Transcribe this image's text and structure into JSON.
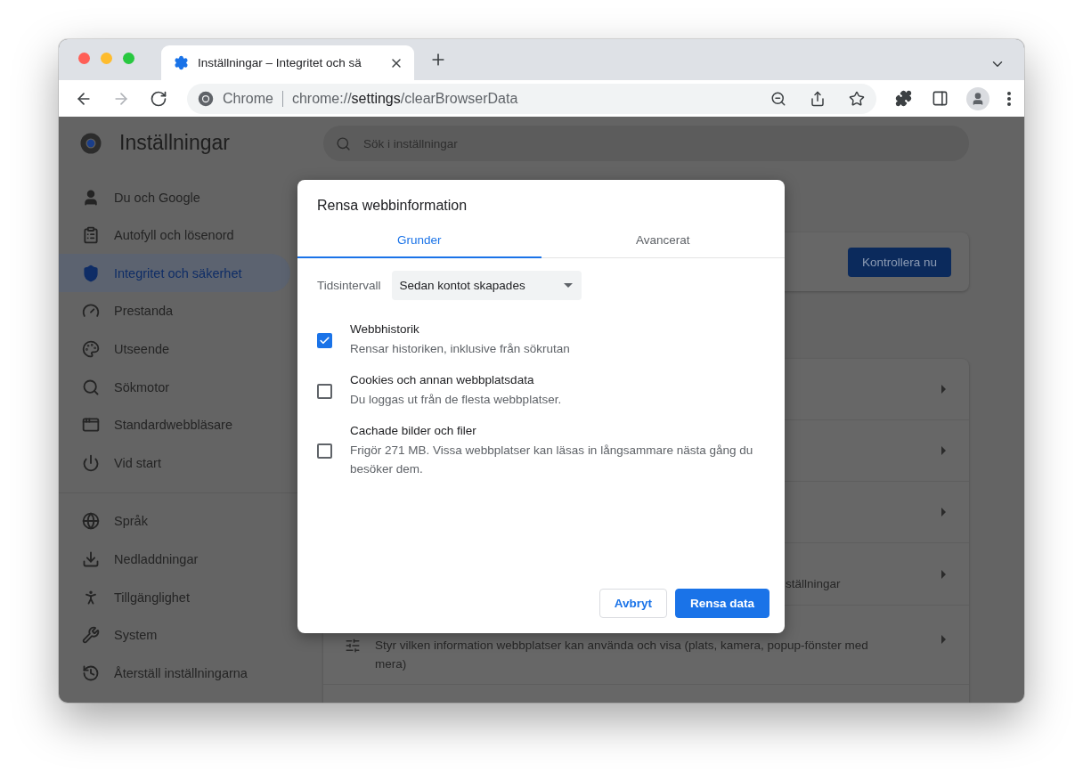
{
  "browser": {
    "tabs": [
      {
        "title": "Inställningar – Integritet och sä",
        "selected": true
      }
    ],
    "nav_buttons": [
      {
        "kind": "back",
        "disabled": false
      },
      {
        "kind": "forward",
        "disabled": true
      },
      {
        "kind": "reload",
        "disabled": false
      }
    ],
    "omnibox": {
      "site_label": "Chrome",
      "url": "chrome://**settings**/clearBrowserData"
    }
  },
  "settings": {
    "title": "Inställningar",
    "search": {
      "placeholder": "Sök i inställningar"
    },
    "sidebar": {
      "groups": [
        [
          {
            "kind": "person",
            "label": "Du och Google",
            "selected": false
          },
          {
            "kind": "clipboard",
            "label": "Autofyll och lösenord",
            "selected": false
          },
          {
            "kind": "shield",
            "label": "Integritet och säkerhet",
            "selected": true
          },
          {
            "kind": "gauge",
            "label": "Prestanda",
            "selected": false
          },
          {
            "kind": "palette",
            "label": "Utseende",
            "selected": false
          },
          {
            "kind": "search",
            "label": "Sökmotor",
            "selected": false
          },
          {
            "kind": "browser",
            "label": "Standardwebbläsare",
            "selected": false
          },
          {
            "kind": "power",
            "label": "Vid start",
            "selected": false
          }
        ],
        [
          {
            "kind": "globe",
            "label": "Språk",
            "selected": false
          },
          {
            "kind": "download",
            "label": "Nedladdningar",
            "selected": false
          },
          {
            "kind": "accessibility",
            "label": "Tillgänglighet",
            "selected": false
          },
          {
            "kind": "wrench",
            "label": "System",
            "selected": false
          },
          {
            "kind": "history",
            "label": "Återställ inställningarna",
            "selected": false
          }
        ]
      ]
    },
    "safety_check": {
      "button": "Kontrollera nu"
    },
    "rows": [
      {
        "kind": "covered"
      },
      {
        "kind": "covered"
      },
      {
        "kind": "covered"
      },
      {
        "kind": "partial",
        "text": "ställningar"
      },
      {
        "kind": "sliders",
        "text": "Styr vilken information webbplatser kan använda och visa (plats, kamera, popup-fönster med mera)"
      }
    ]
  },
  "dialog": {
    "title": "Rensa webbinformation",
    "tabs": [
      {
        "label": "Grunder",
        "selected": true
      },
      {
        "label": "Avancerat",
        "selected": false
      }
    ],
    "time_range": {
      "label": "Tidsintervall",
      "value": "Sedan kontot skapades"
    },
    "options": [
      {
        "title": "Webbhistorik",
        "description": "Rensar historiken, inklusive från sökrutan",
        "checked": true
      },
      {
        "title": "Cookies och annan webbplatsdata",
        "description": "Du loggas ut från de flesta webbplatser.",
        "checked": false
      },
      {
        "title": "Cachade bilder och filer",
        "description": "Frigör 271 MB. Vissa webbplatser kan läsas in långsammare nästa gång du besöker dem.",
        "checked": false
      }
    ],
    "buttons": [
      {
        "label": "Avbryt",
        "kind": "secondary"
      },
      {
        "label": "Rensa data",
        "kind": "primary"
      }
    ]
  }
}
